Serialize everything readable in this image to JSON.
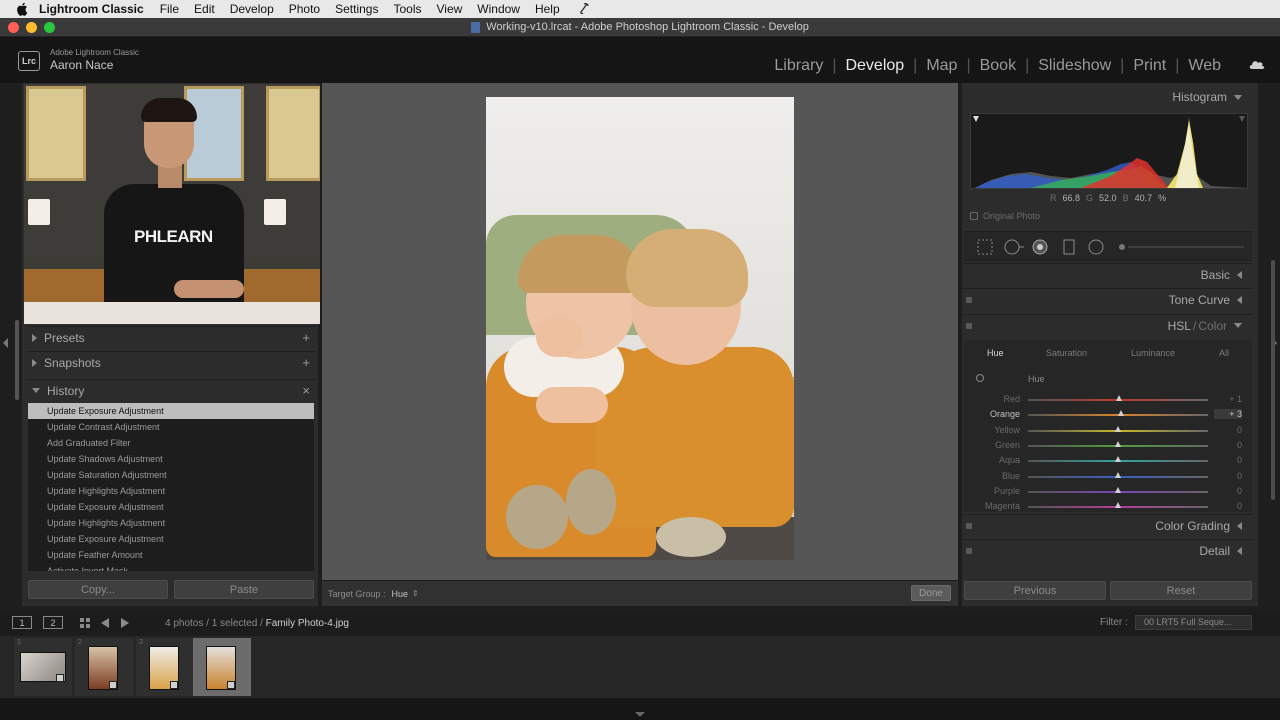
{
  "menubar": {
    "app_name": "Lightroom Classic",
    "items": [
      "File",
      "Edit",
      "Develop",
      "Photo",
      "Settings",
      "Tools",
      "View",
      "Window",
      "Help"
    ]
  },
  "window": {
    "title": "Working-v10.lrcat - Adobe Photoshop Lightroom Classic - Develop"
  },
  "identity": {
    "badge": "Lrc",
    "product": "Adobe Lightroom Classic",
    "user": "Aaron Nace"
  },
  "modules": {
    "items": [
      "Library",
      "Develop",
      "Map",
      "Book",
      "Slideshow",
      "Print",
      "Web"
    ],
    "active": "Develop"
  },
  "video_overlay": {
    "shirt_text": "PHLEARN"
  },
  "left_panel": {
    "presets": {
      "label": "Presets",
      "action": "+"
    },
    "snapshots": {
      "label": "Snapshots",
      "action": "+"
    },
    "history": {
      "label": "History",
      "action": "×",
      "items": [
        "Update Exposure Adjustment",
        "Update Contrast Adjustment",
        "Add Graduated Filter",
        "Update Shadows Adjustment",
        "Update Saturation Adjustment",
        "Update Highlights Adjustment",
        "Update Exposure Adjustment",
        "Update Highlights Adjustment",
        "Update Exposure Adjustment",
        "Update Feather Amount",
        "Activate Invert Mask"
      ],
      "selected_index": 0
    },
    "copy_label": "Copy...",
    "paste_label": "Paste"
  },
  "center": {
    "target_group_label": "Target Group :",
    "target_group_value": "Hue",
    "done_label": "Done"
  },
  "right_panel": {
    "histogram": {
      "label": "Histogram",
      "r_label": "R",
      "r_value": "66.8",
      "g_label": "G",
      "g_value": "52.0",
      "b_label": "B",
      "b_value": "40.7",
      "unit": "%",
      "original_photo_label": "Original Photo"
    },
    "basic_label": "Basic",
    "tone_curve_label": "Tone Curve",
    "hsl": {
      "label": "HSL",
      "label_sep": "/",
      "label_alt": "Color",
      "tabs": [
        "Hue",
        "Saturation",
        "Luminance",
        "All"
      ],
      "active_tab": "Hue",
      "section_title": "Hue",
      "sliders": [
        {
          "name": "Red",
          "value": "+ 1",
          "level": 1,
          "color": "#c0392b"
        },
        {
          "name": "Orange",
          "value": "+ 3",
          "level": 3,
          "color": "#d9822b"
        },
        {
          "name": "Yellow",
          "value": "0",
          "level": 0,
          "color": "#c8b82a"
        },
        {
          "name": "Green",
          "value": "0",
          "level": 0,
          "color": "#4f9e3a"
        },
        {
          "name": "Aqua",
          "value": "0",
          "level": 0,
          "color": "#2fa3a0"
        },
        {
          "name": "Blue",
          "value": "0",
          "level": 0,
          "color": "#3a5fc2"
        },
        {
          "name": "Purple",
          "value": "0",
          "level": 0,
          "color": "#7d45b5"
        },
        {
          "name": "Magenta",
          "value": "0",
          "level": 0,
          "color": "#b53d9a"
        }
      ],
      "active_slider": "Orange"
    },
    "color_grading_label": "Color Grading",
    "detail_label": "Detail",
    "previous_label": "Previous",
    "reset_label": "Reset"
  },
  "filmstrip_bar": {
    "page1": "1",
    "page2": "2",
    "info_prefix": "4 photos / 1 selected /",
    "filename": "Family Photo-4.jpg",
    "filter_label": "Filter :",
    "filter_value": "00 LRT5 Full Seque..."
  },
  "filmstrip": {
    "thumbnails": [
      {
        "index": "1",
        "selected": false
      },
      {
        "index": "2",
        "selected": false
      },
      {
        "index": "3",
        "selected": false
      },
      {
        "index": "4",
        "selected": true
      }
    ]
  },
  "colors": {
    "panel_bg": "#2c2c2c",
    "center_bg": "#565656",
    "selected_history": "#bdbdbd",
    "active_module": "#e8e8e8"
  }
}
